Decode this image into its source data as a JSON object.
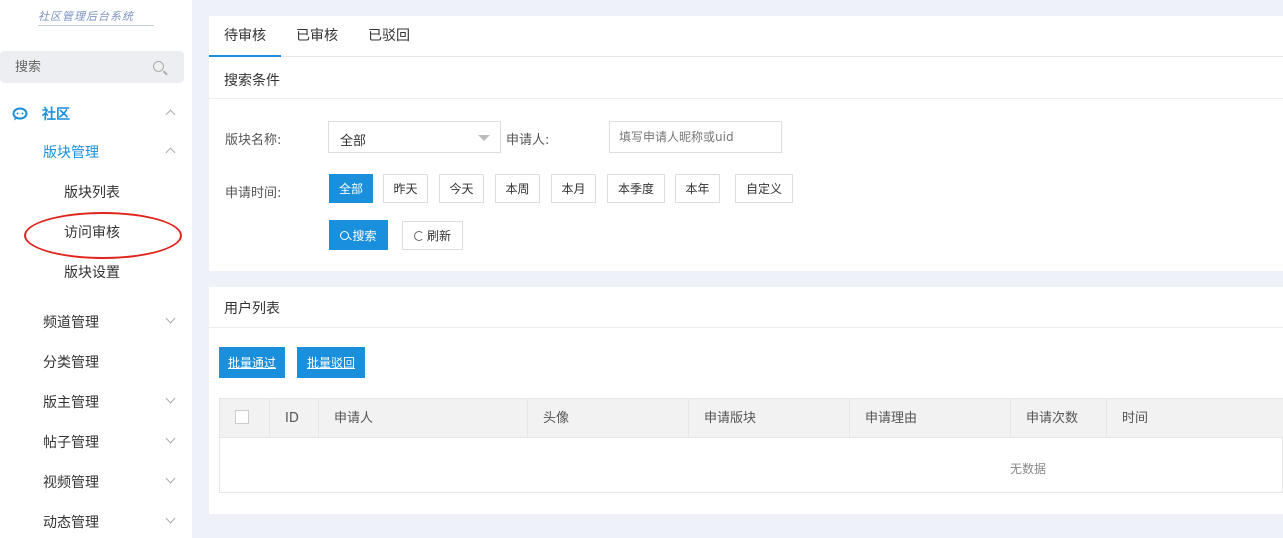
{
  "sidebar": {
    "logo_text": "社区管理后台系统",
    "search": {
      "placeholder": "搜索"
    },
    "menu": {
      "community": "社区",
      "board_management": "版块管理",
      "board_list": "版块列表",
      "access_review": "访问审核",
      "board_settings": "版块设置",
      "channel_management": "频道管理",
      "category_management": "分类管理",
      "moderator_management": "版主管理",
      "post_management": "帖子管理",
      "video_management": "视频管理",
      "dynamic_management": "动态管理"
    }
  },
  "tabs": [
    "待审核",
    "已审核",
    "已驳回"
  ],
  "search_section": {
    "title": "搜索条件",
    "board_name_label": "版块名称:",
    "board_name_value": "全部",
    "applicant_label": "申请人:",
    "applicant_placeholder": "填写申请人昵称或uid",
    "time_label": "申请时间:",
    "time_options": [
      "全部",
      "昨天",
      "今天",
      "本周",
      "本月",
      "本季度",
      "本年",
      "自定义"
    ],
    "search_button": "搜索",
    "refresh_button": "刷新"
  },
  "user_list": {
    "title": "用户列表",
    "batch_approve": "批量通过",
    "batch_reject": "批量驳回",
    "columns": [
      "ID",
      "申请人",
      "头像",
      "申请版块",
      "申请理由",
      "申请次数",
      "时间"
    ],
    "empty_text": "无数据"
  },
  "colors": {
    "accent": "#1a8fdb",
    "annotation": "#e0241b"
  }
}
